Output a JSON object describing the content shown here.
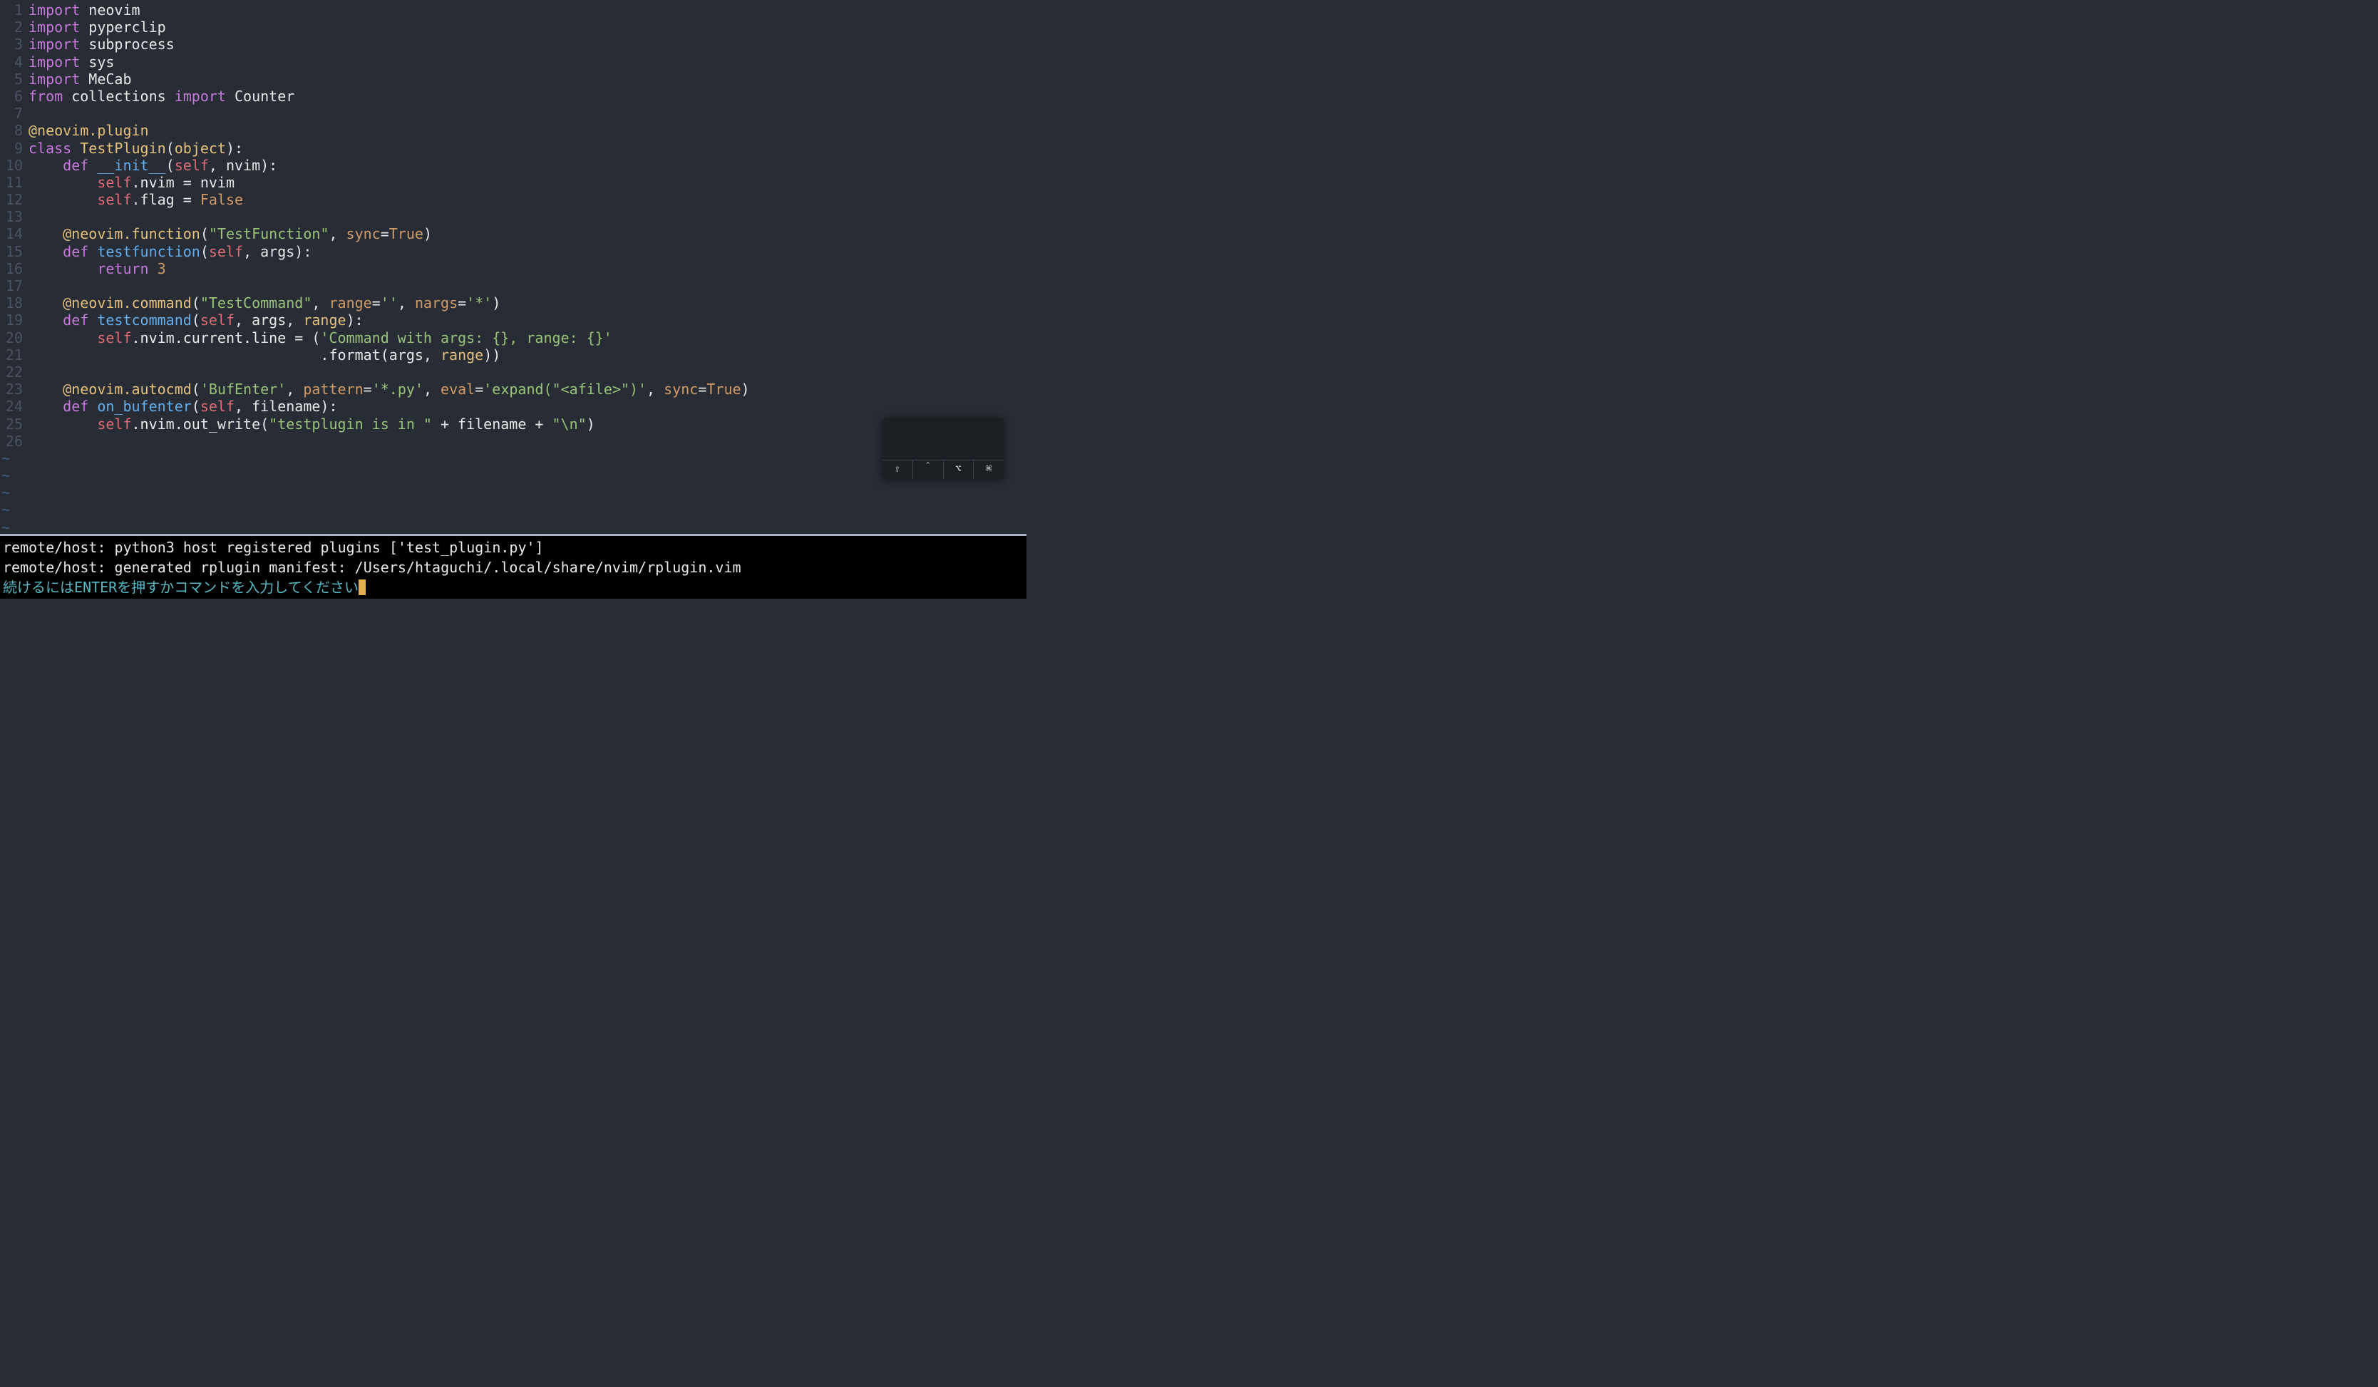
{
  "lines": [
    {
      "n": 1,
      "tokens": [
        [
          "kw",
          "import"
        ],
        [
          "ident",
          " neovim"
        ]
      ]
    },
    {
      "n": 2,
      "tokens": [
        [
          "kw",
          "import"
        ],
        [
          "ident",
          " pyperclip"
        ]
      ]
    },
    {
      "n": 3,
      "tokens": [
        [
          "kw",
          "import"
        ],
        [
          "ident",
          " subprocess"
        ]
      ]
    },
    {
      "n": 4,
      "tokens": [
        [
          "kw",
          "import"
        ],
        [
          "ident",
          " sys"
        ]
      ]
    },
    {
      "n": 5,
      "tokens": [
        [
          "kw",
          "import"
        ],
        [
          "ident",
          " MeCab"
        ]
      ]
    },
    {
      "n": 6,
      "tokens": [
        [
          "kw",
          "from"
        ],
        [
          "ident",
          " collections "
        ],
        [
          "kw",
          "import"
        ],
        [
          "ident",
          " Counter"
        ]
      ]
    },
    {
      "n": 7,
      "tokens": []
    },
    {
      "n": 8,
      "tokens": [
        [
          "deco",
          "@neovim.plugin"
        ]
      ]
    },
    {
      "n": 9,
      "tokens": [
        [
          "kw",
          "class"
        ],
        [
          "ident",
          " "
        ],
        [
          "builtin",
          "TestPlugin"
        ],
        [
          "punct",
          "("
        ],
        [
          "builtin",
          "object"
        ],
        [
          "punct",
          "):"
        ]
      ]
    },
    {
      "n": 10,
      "tokens": [
        [
          "ident",
          "    "
        ],
        [
          "kw",
          "def"
        ],
        [
          "ident",
          " "
        ],
        [
          "func",
          "__init__"
        ],
        [
          "punct",
          "("
        ],
        [
          "self",
          "self"
        ],
        [
          "punct",
          ", nvim):"
        ]
      ]
    },
    {
      "n": 11,
      "tokens": [
        [
          "ident",
          "        "
        ],
        [
          "self",
          "self"
        ],
        [
          "punct",
          ".nvim = nvim"
        ]
      ]
    },
    {
      "n": 12,
      "tokens": [
        [
          "ident",
          "        "
        ],
        [
          "self",
          "self"
        ],
        [
          "punct",
          ".flag = "
        ],
        [
          "const",
          "False"
        ]
      ]
    },
    {
      "n": 13,
      "tokens": []
    },
    {
      "n": 14,
      "tokens": [
        [
          "ident",
          "    "
        ],
        [
          "deco",
          "@neovim.function"
        ],
        [
          "punct",
          "("
        ],
        [
          "str",
          "\"TestFunction\""
        ],
        [
          "punct",
          ", "
        ],
        [
          "param",
          "sync"
        ],
        [
          "punct",
          "="
        ],
        [
          "const",
          "True"
        ],
        [
          "punct",
          ")"
        ]
      ]
    },
    {
      "n": 15,
      "tokens": [
        [
          "ident",
          "    "
        ],
        [
          "kw",
          "def"
        ],
        [
          "ident",
          " "
        ],
        [
          "func",
          "testfunction"
        ],
        [
          "punct",
          "("
        ],
        [
          "self",
          "self"
        ],
        [
          "punct",
          ", args):"
        ]
      ]
    },
    {
      "n": 16,
      "tokens": [
        [
          "ident",
          "        "
        ],
        [
          "kw",
          "return"
        ],
        [
          "ident",
          " "
        ],
        [
          "num",
          "3"
        ]
      ]
    },
    {
      "n": 17,
      "tokens": []
    },
    {
      "n": 18,
      "tokens": [
        [
          "ident",
          "    "
        ],
        [
          "deco",
          "@neovim.command"
        ],
        [
          "punct",
          "("
        ],
        [
          "str",
          "\"TestCommand\""
        ],
        [
          "punct",
          ", "
        ],
        [
          "param",
          "range"
        ],
        [
          "punct",
          "="
        ],
        [
          "str",
          "''"
        ],
        [
          "punct",
          ", "
        ],
        [
          "param",
          "nargs"
        ],
        [
          "punct",
          "="
        ],
        [
          "str",
          "'*'"
        ],
        [
          "punct",
          ")"
        ]
      ]
    },
    {
      "n": 19,
      "tokens": [
        [
          "ident",
          "    "
        ],
        [
          "kw",
          "def"
        ],
        [
          "ident",
          " "
        ],
        [
          "func",
          "testcommand"
        ],
        [
          "punct",
          "("
        ],
        [
          "self",
          "self"
        ],
        [
          "punct",
          ", args, "
        ],
        [
          "builtin",
          "range"
        ],
        [
          "punct",
          "):"
        ]
      ]
    },
    {
      "n": 20,
      "tokens": [
        [
          "ident",
          "        "
        ],
        [
          "self",
          "self"
        ],
        [
          "punct",
          ".nvim.current.line = ("
        ],
        [
          "str",
          "'Command with args: {}, range: {}'"
        ]
      ]
    },
    {
      "n": 21,
      "tokens": [
        [
          "ident",
          "                                  "
        ],
        [
          "punct",
          ".format(args, "
        ],
        [
          "builtin",
          "range"
        ],
        [
          "punct",
          "))"
        ]
      ]
    },
    {
      "n": 22,
      "tokens": []
    },
    {
      "n": 23,
      "tokens": [
        [
          "ident",
          "    "
        ],
        [
          "deco",
          "@neovim.autocmd"
        ],
        [
          "punct",
          "("
        ],
        [
          "str",
          "'BufEnter'"
        ],
        [
          "punct",
          ", "
        ],
        [
          "param",
          "pattern"
        ],
        [
          "punct",
          "="
        ],
        [
          "str",
          "'*.py'"
        ],
        [
          "punct",
          ", "
        ],
        [
          "param",
          "eval"
        ],
        [
          "punct",
          "="
        ],
        [
          "str",
          "'expand(\"<afile>\")'"
        ],
        [
          "punct",
          ", "
        ],
        [
          "param",
          "sync"
        ],
        [
          "punct",
          "="
        ],
        [
          "const",
          "True"
        ],
        [
          "punct",
          ")"
        ]
      ]
    },
    {
      "n": 24,
      "tokens": [
        [
          "ident",
          "    "
        ],
        [
          "kw",
          "def"
        ],
        [
          "ident",
          " "
        ],
        [
          "func",
          "on_bufenter"
        ],
        [
          "punct",
          "("
        ],
        [
          "self",
          "self"
        ],
        [
          "punct",
          ", filename):"
        ]
      ]
    },
    {
      "n": 25,
      "tokens": [
        [
          "ident",
          "        "
        ],
        [
          "self",
          "self"
        ],
        [
          "punct",
          ".nvim.out_write("
        ],
        [
          "str",
          "\"testplugin is in \""
        ],
        [
          "punct",
          " + filename + "
        ],
        [
          "str",
          "\"\\n\""
        ],
        [
          "punct",
          ")"
        ]
      ]
    },
    {
      "n": 26,
      "tokens": []
    }
  ],
  "empty_rows": 6,
  "tilde_char": "~",
  "messages": {
    "line1": "remote/host: python3 host registered plugins ['test_plugin.py']",
    "line2": "remote/host: generated rplugin manifest: /Users/htaguchi/.local/share/nvim/rplugin.vim",
    "prompt": "続けるにはENTERを押すかコマンドを入力してください"
  },
  "ime": {
    "keys": [
      "⇧",
      "＾",
      "⌥",
      "⌘"
    ]
  }
}
